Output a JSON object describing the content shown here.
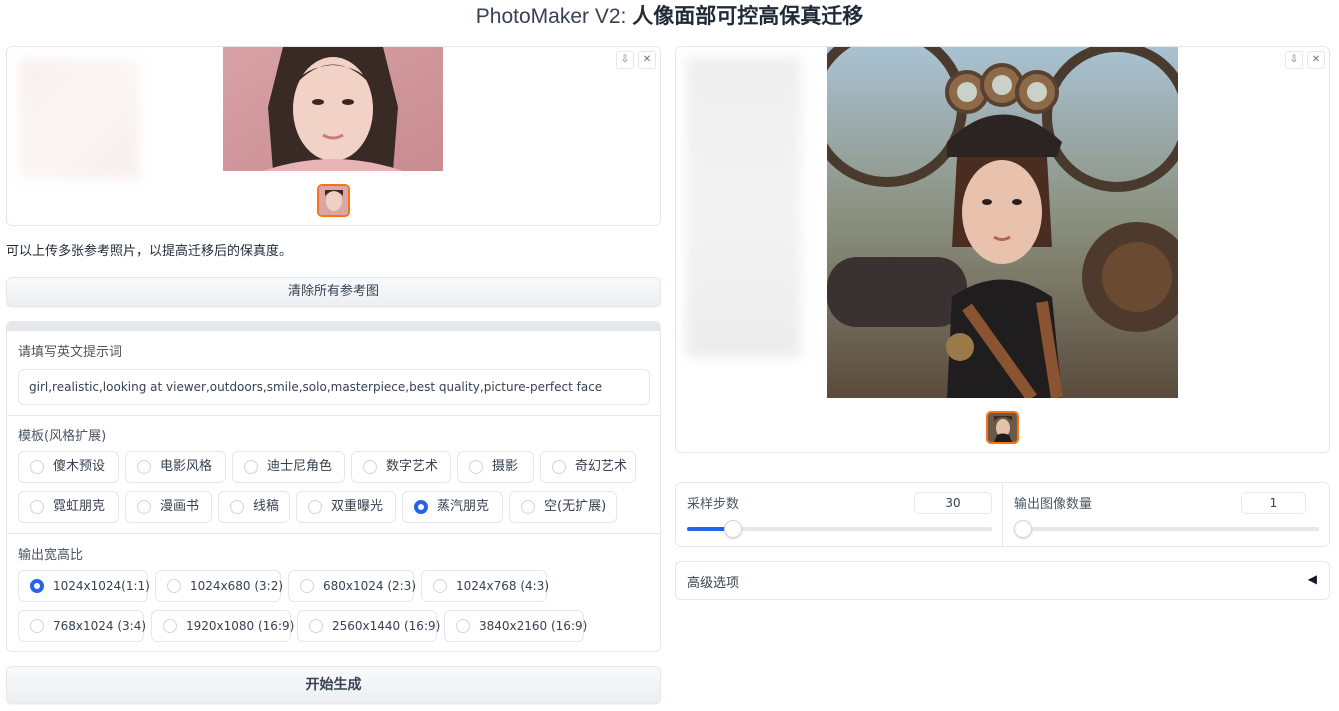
{
  "title": {
    "prefix": "PhotoMaker V2: ",
    "main": "人像面部可控高保真迁移"
  },
  "icons": {
    "download": "download-icon",
    "close": "close-icon",
    "collapse": "triangle-left-icon"
  },
  "reference_gallery": {
    "download_glyph": "⇩",
    "close_glyph": "✕"
  },
  "hint_text": "可以上传多张参考照片，以提高迁移后的保真度。",
  "clear_button_label": "清除所有参考图",
  "prompt": {
    "label": "请填写英文提示词",
    "value": "girl,realistic,looking at viewer,outdoors,smile,solo,masterpiece,best quality,picture-perfect face"
  },
  "template": {
    "label": "模板(风格扩展)",
    "options": [
      "傻木预设",
      "电影风格",
      "迪士尼角色",
      "数字艺术",
      "摄影",
      "奇幻艺术",
      "霓虹朋克",
      "漫画书",
      "线稿",
      "双重曝光",
      "蒸汽朋克",
      "空(无扩展)"
    ],
    "selected": "蒸汽朋克"
  },
  "aspect": {
    "label": "输出宽高比",
    "options": [
      "1024x1024(1:1)",
      "1024x680 (3:2)",
      "680x1024 (2:3)",
      "1024x768 (4:3)",
      "768x1024 (3:4)",
      "1920x1080 (16:9)",
      "2560x1440 (16:9)",
      "3840x2160 (16:9)"
    ],
    "selected": "1024x1024(1:1)"
  },
  "generate_button_label": "开始生成",
  "sampling_steps": {
    "label": "采样步数",
    "value": "30",
    "fraction": 0.15
  },
  "num_images": {
    "label": "输出图像数量",
    "value": "1",
    "fraction": 0.0
  },
  "advanced": {
    "label": "高级选项",
    "arrow": "◀"
  },
  "colors": {
    "accent": "#2563eb",
    "thumb_border": "#f97316"
  }
}
